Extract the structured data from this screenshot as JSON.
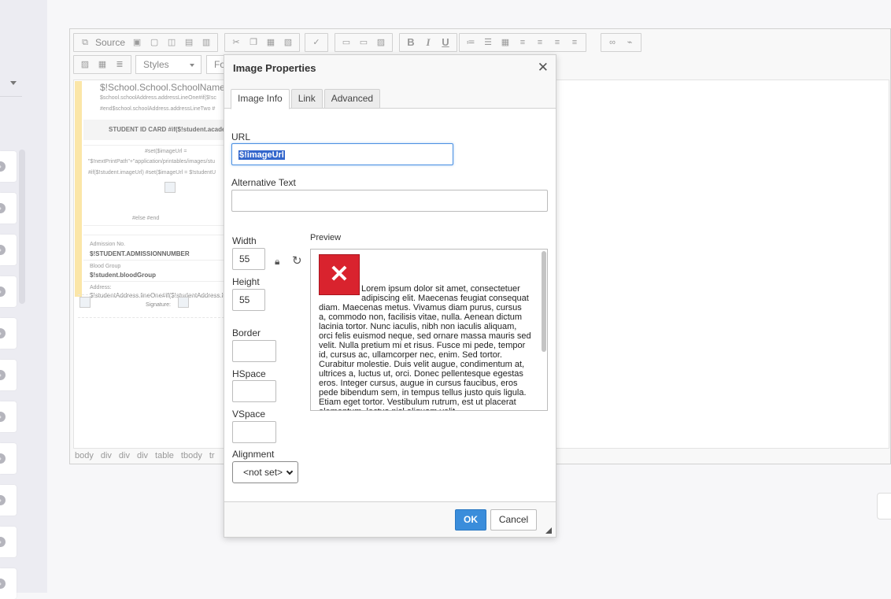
{
  "sidebar": {
    "cards": [
      {
        "icon": "chevron-right-icon"
      },
      {
        "icon": "chevron-right-icon"
      },
      {
        "icon": "chevron-right-icon"
      },
      {
        "icon": "chevron-right-icon"
      },
      {
        "icon": "chevron-right-icon"
      },
      {
        "icon": "chevron-right-icon"
      },
      {
        "icon": "chevron-right-icon"
      },
      {
        "icon": "chevron-right-icon"
      },
      {
        "icon": "chevron-right-icon"
      },
      {
        "icon": "chevron-right-icon"
      }
    ]
  },
  "toolbar": {
    "source_label": "Source",
    "styles_label": "Styles",
    "format_label": "Fo"
  },
  "document": {
    "school_name": "$!School.School.SchoolName",
    "address_line1": "$school.schoolAddress.addressLineOne#if($!sc",
    "address_line2": "#end$school.schoolAddress.addressLineTwo #",
    "id_card_line": "STUDENT ID CARD #if($!student.academi",
    "set_line1": "#set($imageUrl =",
    "set_line2": "\"$!nextPrintPath\"+\"application/printables/images/stu",
    "set_line3": "#if($!student.imageUrl) #set($imageUrl = $!studentU",
    "else_line": "#else #end",
    "admission_label": "Admission No.",
    "admission_value": "$!STUDENT.ADMISSIONNUMBER",
    "blood_label": "Blood Group",
    "blood_value": "$!student.bloodGroup",
    "address_label": "Address:",
    "address_value": "$!studentAddress.lineOne#if($!studentAddress.lineTwo)",
    "signature_label": "Signature:"
  },
  "statusbar": [
    "body",
    "div",
    "div",
    "div",
    "table",
    "tbody",
    "tr"
  ],
  "dialog": {
    "title": "Image Properties",
    "close_glyph": "✕",
    "tabs": [
      "Image Info",
      "Link",
      "Advanced"
    ],
    "url_label": "URL",
    "url_value": "$!imageUrl",
    "alt_label": "Alternative Text",
    "alt_value": "",
    "width_label": "Width",
    "width_value": "55",
    "height_label": "Height",
    "height_value": "55",
    "border_label": "Border",
    "hspace_label": "HSpace",
    "vspace_label": "VSpace",
    "alignment_label": "Alignment",
    "alignment_value": "<not set>",
    "preview_label": "Preview",
    "preview_text": "Lorem ipsum dolor sit amet, consectetuer adipiscing elit. Maecenas feugiat consequat diam. Maecenas metus. Vivamus diam purus, cursus a, commodo non, facilisis vitae, nulla. Aenean dictum lacinia tortor. Nunc iaculis, nibh non iaculis aliquam, orci felis euismod neque, sed ornare massa mauris sed velit. Nulla pretium mi et risus. Fusce mi pede, tempor id, cursus ac, ullamcorper nec, enim. Sed tortor. Curabitur molestie. Duis velit augue, condimentum at, ultrices a, luctus ut, orci. Donec pellentesque egestas eros. Integer cursus, augue in cursus faucibus, eros pede bibendum sem, in tempus tellus justo quis ligula. Etiam eget tortor. Vestibulum rutrum, est ut placerat elementum, lectus nisl aliquam velit.",
    "ok_label": "OK",
    "cancel_label": "Cancel"
  },
  "colors": {
    "accent": "#3a8ddb",
    "error_image": "#d9232e",
    "selection": "#3366cc"
  }
}
